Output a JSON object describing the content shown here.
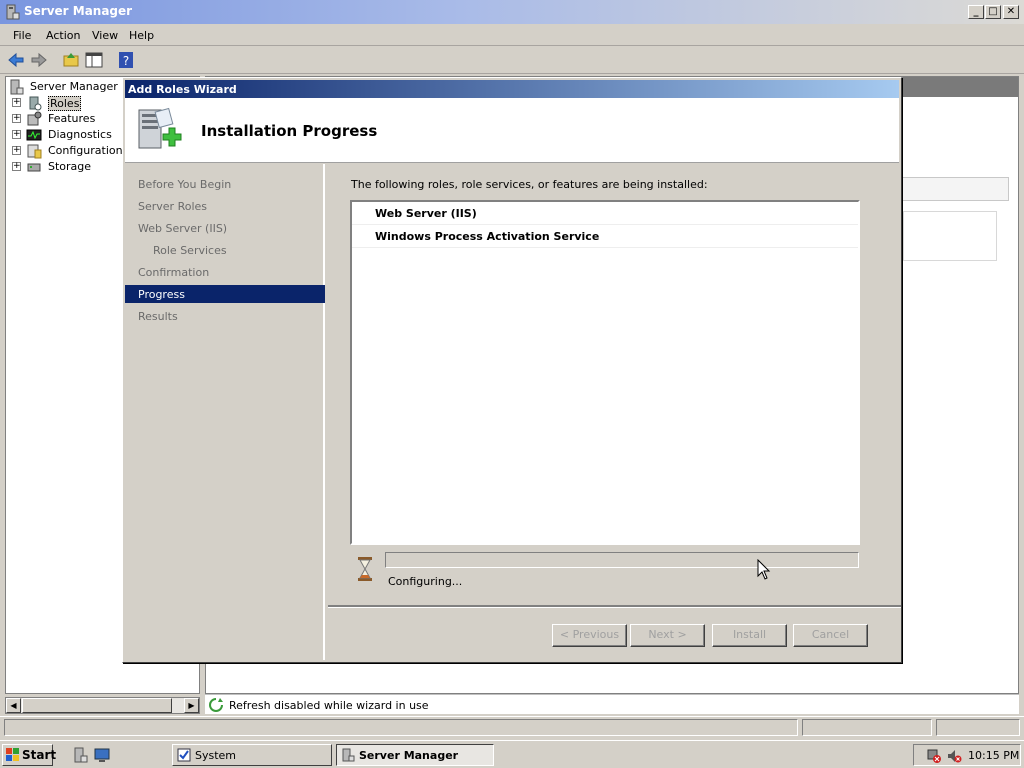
{
  "window": {
    "title": "Server Manager"
  },
  "menu": [
    "File",
    "Action",
    "View",
    "Help"
  ],
  "tree": {
    "root": "Server Manager (W",
    "items": [
      "Roles",
      "Features",
      "Diagnostics",
      "Configuration",
      "Storage"
    ]
  },
  "right_pane": {
    "status": "Refresh disabled while wizard in use"
  },
  "wizard": {
    "title": "Add Roles Wizard",
    "heading": "Installation Progress",
    "nav": [
      "Before You Begin",
      "Server Roles",
      "Web Server (IIS)",
      "Role Services",
      "Confirmation",
      "Progress",
      "Results"
    ],
    "nav_selected": "Progress",
    "lead": "The following roles, role services, or features are being installed:",
    "items": [
      "Web Server (IIS)",
      "Windows Process Activation Service"
    ],
    "progress_fraction": 0.0,
    "status": "Configuring...",
    "buttons": {
      "previous": "< Previous",
      "next": "Next >",
      "install": "Install",
      "cancel": "Cancel"
    }
  },
  "taskbar": {
    "start": "Start",
    "tasks": [
      "System",
      "Server Manager"
    ],
    "clock": "10:15 PM"
  },
  "colors": {
    "selection": "#0a246a",
    "title_gradient_start": "#7a96df"
  }
}
